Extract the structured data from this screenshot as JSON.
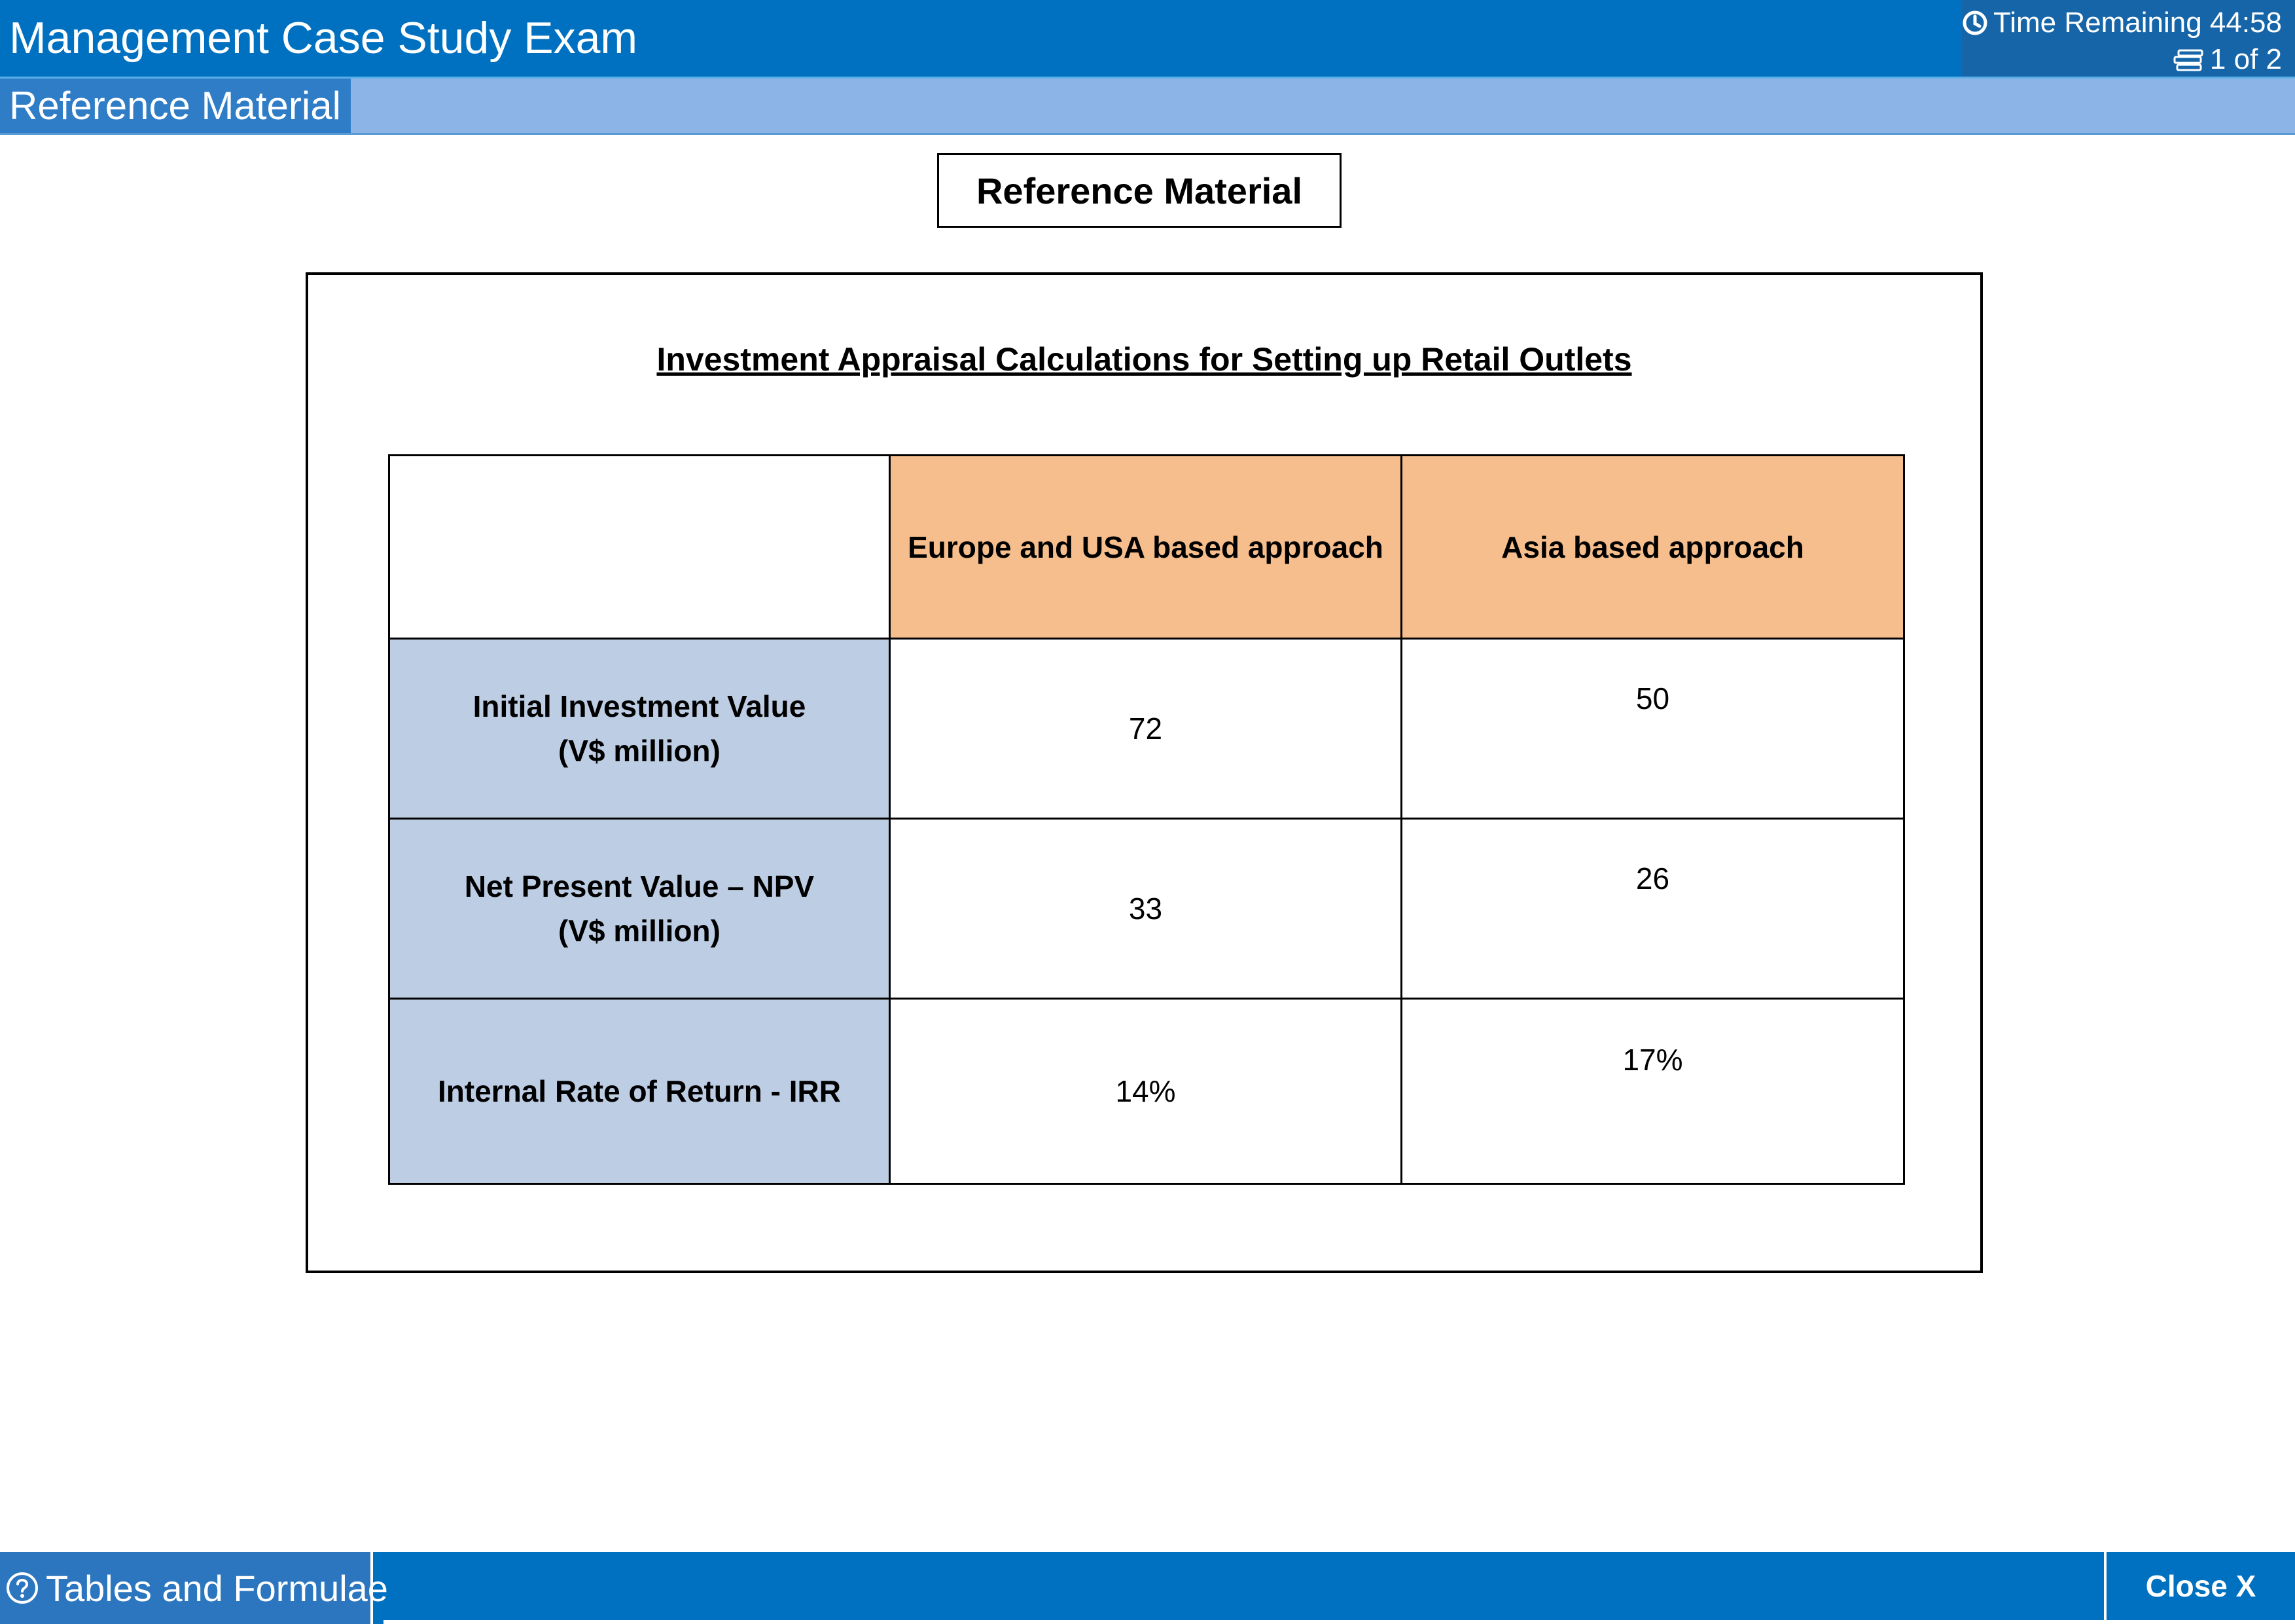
{
  "header": {
    "title": "Management Case Study Exam",
    "timer_text": "Time Remaining 44:58",
    "timer_icon": "clock-icon",
    "page_text": "1 of 2",
    "page_icon": "pages-icon"
  },
  "subheader": {
    "active_tab": "Reference Material"
  },
  "content": {
    "label": "Reference Material",
    "heading": "Investment Appraisal Calculations for Setting up Retail Outlets",
    "table": {
      "columns": [
        "",
        "Europe and USA based approach",
        "Asia based approach"
      ],
      "rows": [
        {
          "label_line1": "Initial Investment Value",
          "label_line2": "(V$ million)",
          "europe_usa": "72",
          "asia": "50"
        },
        {
          "label_line1": "Net Present Value – NPV",
          "label_line2": "(V$ million)",
          "europe_usa": "33",
          "asia": "26"
        },
        {
          "label_line1": "Internal Rate of Return - IRR",
          "label_line2": "",
          "europe_usa": "14%",
          "asia": "17%"
        }
      ]
    }
  },
  "footer": {
    "tables_button": "Tables and Formulae",
    "tables_icon": "help-icon",
    "close_button": "Close X"
  },
  "colors": {
    "header_blue": "#0070c0",
    "subheader_blue": "#8db4e6",
    "column_header_orange": "#f7be8d",
    "row_header_blue": "#bdcde4"
  }
}
